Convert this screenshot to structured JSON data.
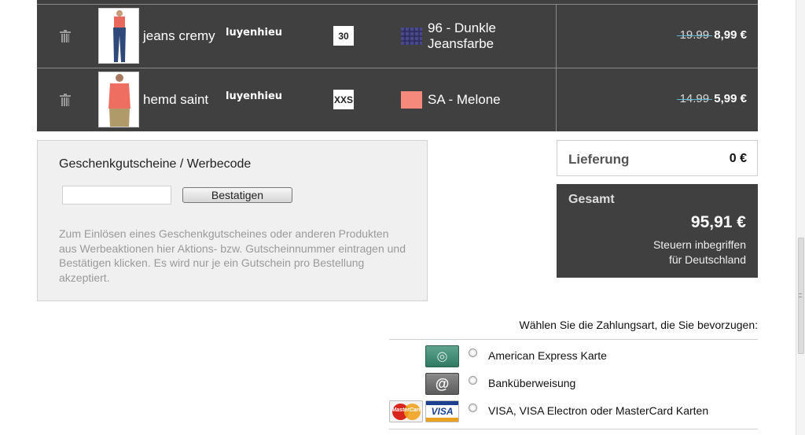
{
  "cart": {
    "items": [
      {
        "name": "jeans cremy",
        "seller": "luyenhieu",
        "size": "30",
        "color_label_line1": "96 - Dunkle",
        "color_label_line2": "Jeansfarbe",
        "old_price": "19.99",
        "new_price": "8,99 €",
        "swatch_color": "#33335e"
      },
      {
        "name": "hemd saint",
        "seller": "luyenhieu",
        "size": "XXS",
        "color_label_line1": "SA - Melone",
        "color_label_line2": "",
        "old_price": "14.99",
        "new_price": "5,99 €",
        "swatch_color": "#f58a7c"
      }
    ],
    "delete_icon": "trash-icon"
  },
  "voucher": {
    "title": "Geschenkgutscheine / Werbecode",
    "input_value": "",
    "button_label": "Bestatigen",
    "info_text": "Zum Einlösen eines Geschenkgutscheines oder anderen Produkten aus Werbeaktionen hier Aktions- bzw. Gutscheinnummer eintragen und Bestätigen klicken. Es wird nur je ein Gutschein pro Bestellung akzeptiert."
  },
  "summary": {
    "delivery_label": "Lieferung",
    "delivery_value": "0 €",
    "total_label": "Gesamt",
    "total_value": "95,91 €",
    "tax_line1": "Steuern inbegriffen",
    "tax_line2": "für Deutschland"
  },
  "payment": {
    "title": "Wählen Sie die Zahlungsart, die Sie bevorzugen:",
    "methods": [
      {
        "label": "American Express Karte",
        "icon": "amex-card-icon"
      },
      {
        "label": "Banküberweisung",
        "icon": "bank-transfer-icon"
      },
      {
        "label": "VISA, VISA Electron oder MasterCard Karten",
        "icon": "visa-mastercard-icon"
      }
    ]
  },
  "colors": {
    "cart_bg": "#404040",
    "total_bg": "#404040",
    "price_strike": "#5fb7d6"
  }
}
